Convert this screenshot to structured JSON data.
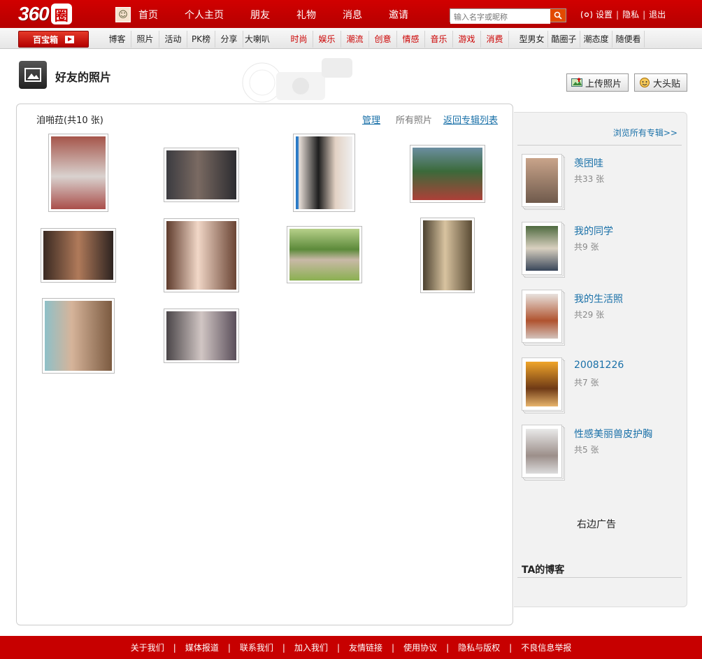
{
  "topbar": {
    "logo_num": "360",
    "logo_char": "圈",
    "nav": [
      "首页",
      "个人主页",
      "朋友",
      "礼物",
      "消息",
      "邀请"
    ],
    "search_placeholder": "输入名字或昵称",
    "links": {
      "settings": "设置",
      "privacy": "隐私",
      "logout": "退出"
    }
  },
  "nav2": {
    "baibao": "百宝箱",
    "items": [
      "博客",
      "照片",
      "活动",
      "PK榜",
      "分享",
      "大喇叭"
    ],
    "red_items": [
      "时尚",
      "娱乐",
      "潮流",
      "创意",
      "情感",
      "音乐",
      "游戏",
      "消费"
    ],
    "right_items": [
      "型男女",
      "酷圈子",
      "潮态度",
      "随便看"
    ]
  },
  "header": {
    "title": "好友的照片",
    "upload_btn": "上传照片",
    "datou_btn": "大头贴"
  },
  "album": {
    "name": "洎啪菈(共10 张)",
    "manage": "管理",
    "all_photos": "所有照片",
    "back_link": "返回专辑列表"
  },
  "sidebar": {
    "browse_all": "浏览所有专辑>>",
    "albums": [
      {
        "name": "羡囨哇",
        "count": "共33 张"
      },
      {
        "name": "我的同学",
        "count": "共9 张"
      },
      {
        "name": "我的生活照",
        "count": "共29 张"
      },
      {
        "name": "20081226",
        "count": "共7 张"
      },
      {
        "name": "性感美丽兽皮护胸",
        "count": "共5 张"
      }
    ],
    "ad": "右边广告",
    "blog_title": "TA的博客"
  },
  "footer": [
    "关于我们",
    "媒体报道",
    "联系我们",
    "加入我们",
    "友情链接",
    "使用协议",
    "隐私与版权",
    "不良信息举报"
  ],
  "colors": {
    "brand_red": "#c70000",
    "link_blue": "#1970a8"
  },
  "icons": [
    "user-avatar-icon",
    "search-icon",
    "settings-icon",
    "play-icon",
    "photo-album-icon",
    "upload-photo-icon",
    "sticker-icon"
  ]
}
